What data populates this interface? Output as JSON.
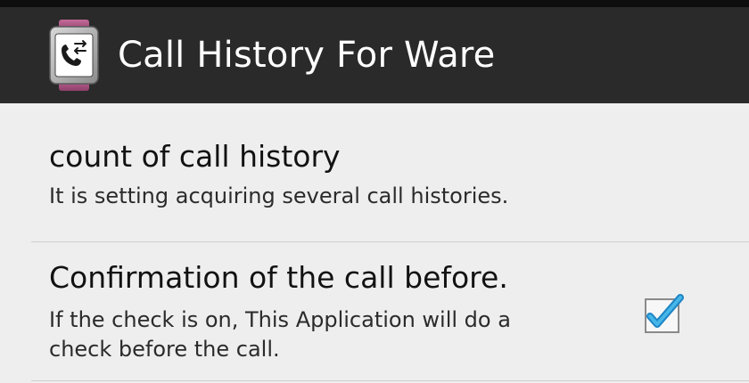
{
  "actionbar": {
    "title": "Call History For Ware",
    "icon": "phone-swap-watch-icon"
  },
  "preferences": [
    {
      "title": "count of call history",
      "summary": "It is setting acquiring several call histories."
    },
    {
      "title": "Confirmation of the call before.",
      "summary": "If the check is on, This Application will do a check before the call.",
      "checked": true
    }
  ],
  "colors": {
    "actionbar": "#2a2a2a",
    "background": "#eeeeee",
    "check_accent": "#33a9dd",
    "icon_band": "#b15a8a"
  }
}
